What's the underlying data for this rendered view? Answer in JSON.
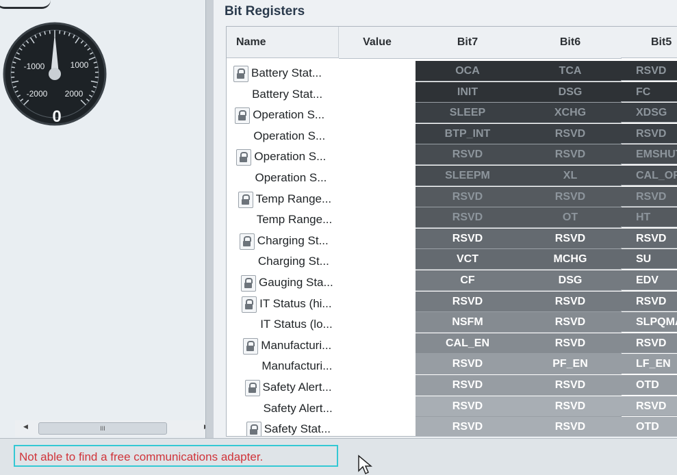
{
  "gauge": {
    "scale_labels": [
      "-1000",
      "1000",
      "-2000",
      "2000"
    ],
    "value": "0"
  },
  "left_scroll": {
    "thumb_label": "III"
  },
  "section": {
    "title": "Bit Registers"
  },
  "table": {
    "headers": {
      "name": "Name",
      "value": "Value",
      "bits": [
        "Bit7",
        "Bit6",
        "Bit5"
      ]
    },
    "rows": [
      {
        "name": "Battery Stat...",
        "locked": true,
        "bits": [
          "OCA",
          "TCA",
          "RSVD"
        ],
        "shade": 0
      },
      {
        "name": "Battery Stat...",
        "locked": false,
        "bits": [
          "INIT",
          "DSG",
          "FC"
        ],
        "shade": 0
      },
      {
        "name": "Operation S...",
        "locked": true,
        "bits": [
          "SLEEP",
          "XCHG",
          "XDSG"
        ],
        "shade": 1
      },
      {
        "name": "Operation S...",
        "locked": false,
        "bits": [
          "BTP_INT",
          "RSVD",
          "RSVD"
        ],
        "shade": 1
      },
      {
        "name": "Operation S...",
        "locked": true,
        "bits": [
          "RSVD",
          "RSVD",
          "EMSHUT"
        ],
        "shade": 2
      },
      {
        "name": "Operation S...",
        "locked": false,
        "bits": [
          "SLEEPM",
          "XL",
          "CAL_OFFSET"
        ],
        "shade": 2
      },
      {
        "name": "Temp Range...",
        "locked": true,
        "bits": [
          "RSVD",
          "RSVD",
          "RSVD"
        ],
        "shade": 3
      },
      {
        "name": "Temp Range...",
        "locked": false,
        "bits": [
          "RSVD",
          "OT",
          "HT"
        ],
        "shade": 3
      },
      {
        "name": "Charging St...",
        "locked": true,
        "bits": [
          "RSVD",
          "RSVD",
          "RSVD"
        ],
        "shade": 4
      },
      {
        "name": "Charging St...",
        "locked": false,
        "bits": [
          "VCT",
          "MCHG",
          "SU"
        ],
        "shade": 4
      },
      {
        "name": "Gauging Sta...",
        "locked": true,
        "bits": [
          "CF",
          "DSG",
          "EDV"
        ],
        "shade": 5
      },
      {
        "name": "IT Status (hi...",
        "locked": true,
        "bits": [
          "RSVD",
          "RSVD",
          "RSVD"
        ],
        "shade": 5
      },
      {
        "name": "IT Status (lo...",
        "locked": false,
        "bits": [
          "NSFM",
          "RSVD",
          "SLPQMAX"
        ],
        "shade": 6
      },
      {
        "name": "Manufacturi...",
        "locked": true,
        "bits": [
          "CAL_EN",
          "RSVD",
          "RSVD"
        ],
        "shade": 6
      },
      {
        "name": "Manufacturi...",
        "locked": false,
        "bits": [
          "RSVD",
          "PF_EN",
          "LF_EN"
        ],
        "shade": 7
      },
      {
        "name": "Safety Alert...",
        "locked": true,
        "bits": [
          "RSVD",
          "RSVD",
          "OTD"
        ],
        "shade": 7
      },
      {
        "name": "Safety Alert...",
        "locked": false,
        "bits": [
          "RSVD",
          "RSVD",
          "RSVD"
        ],
        "shade": 8
      },
      {
        "name": "Safety Stat...",
        "locked": true,
        "bits": [
          "RSVD",
          "RSVD",
          "OTD"
        ],
        "shade": 8
      }
    ]
  },
  "status": {
    "message": "Not able to find a free communications adapter."
  },
  "colors": {
    "cell_shades": [
      "#2e3236",
      "#3a3f44",
      "#474c51",
      "#555a5f",
      "#646a70",
      "#747a80",
      "#858b91",
      "#979da3",
      "#a8aeb4"
    ],
    "status_border": "#34c8d4",
    "status_text": "#d0343a"
  }
}
